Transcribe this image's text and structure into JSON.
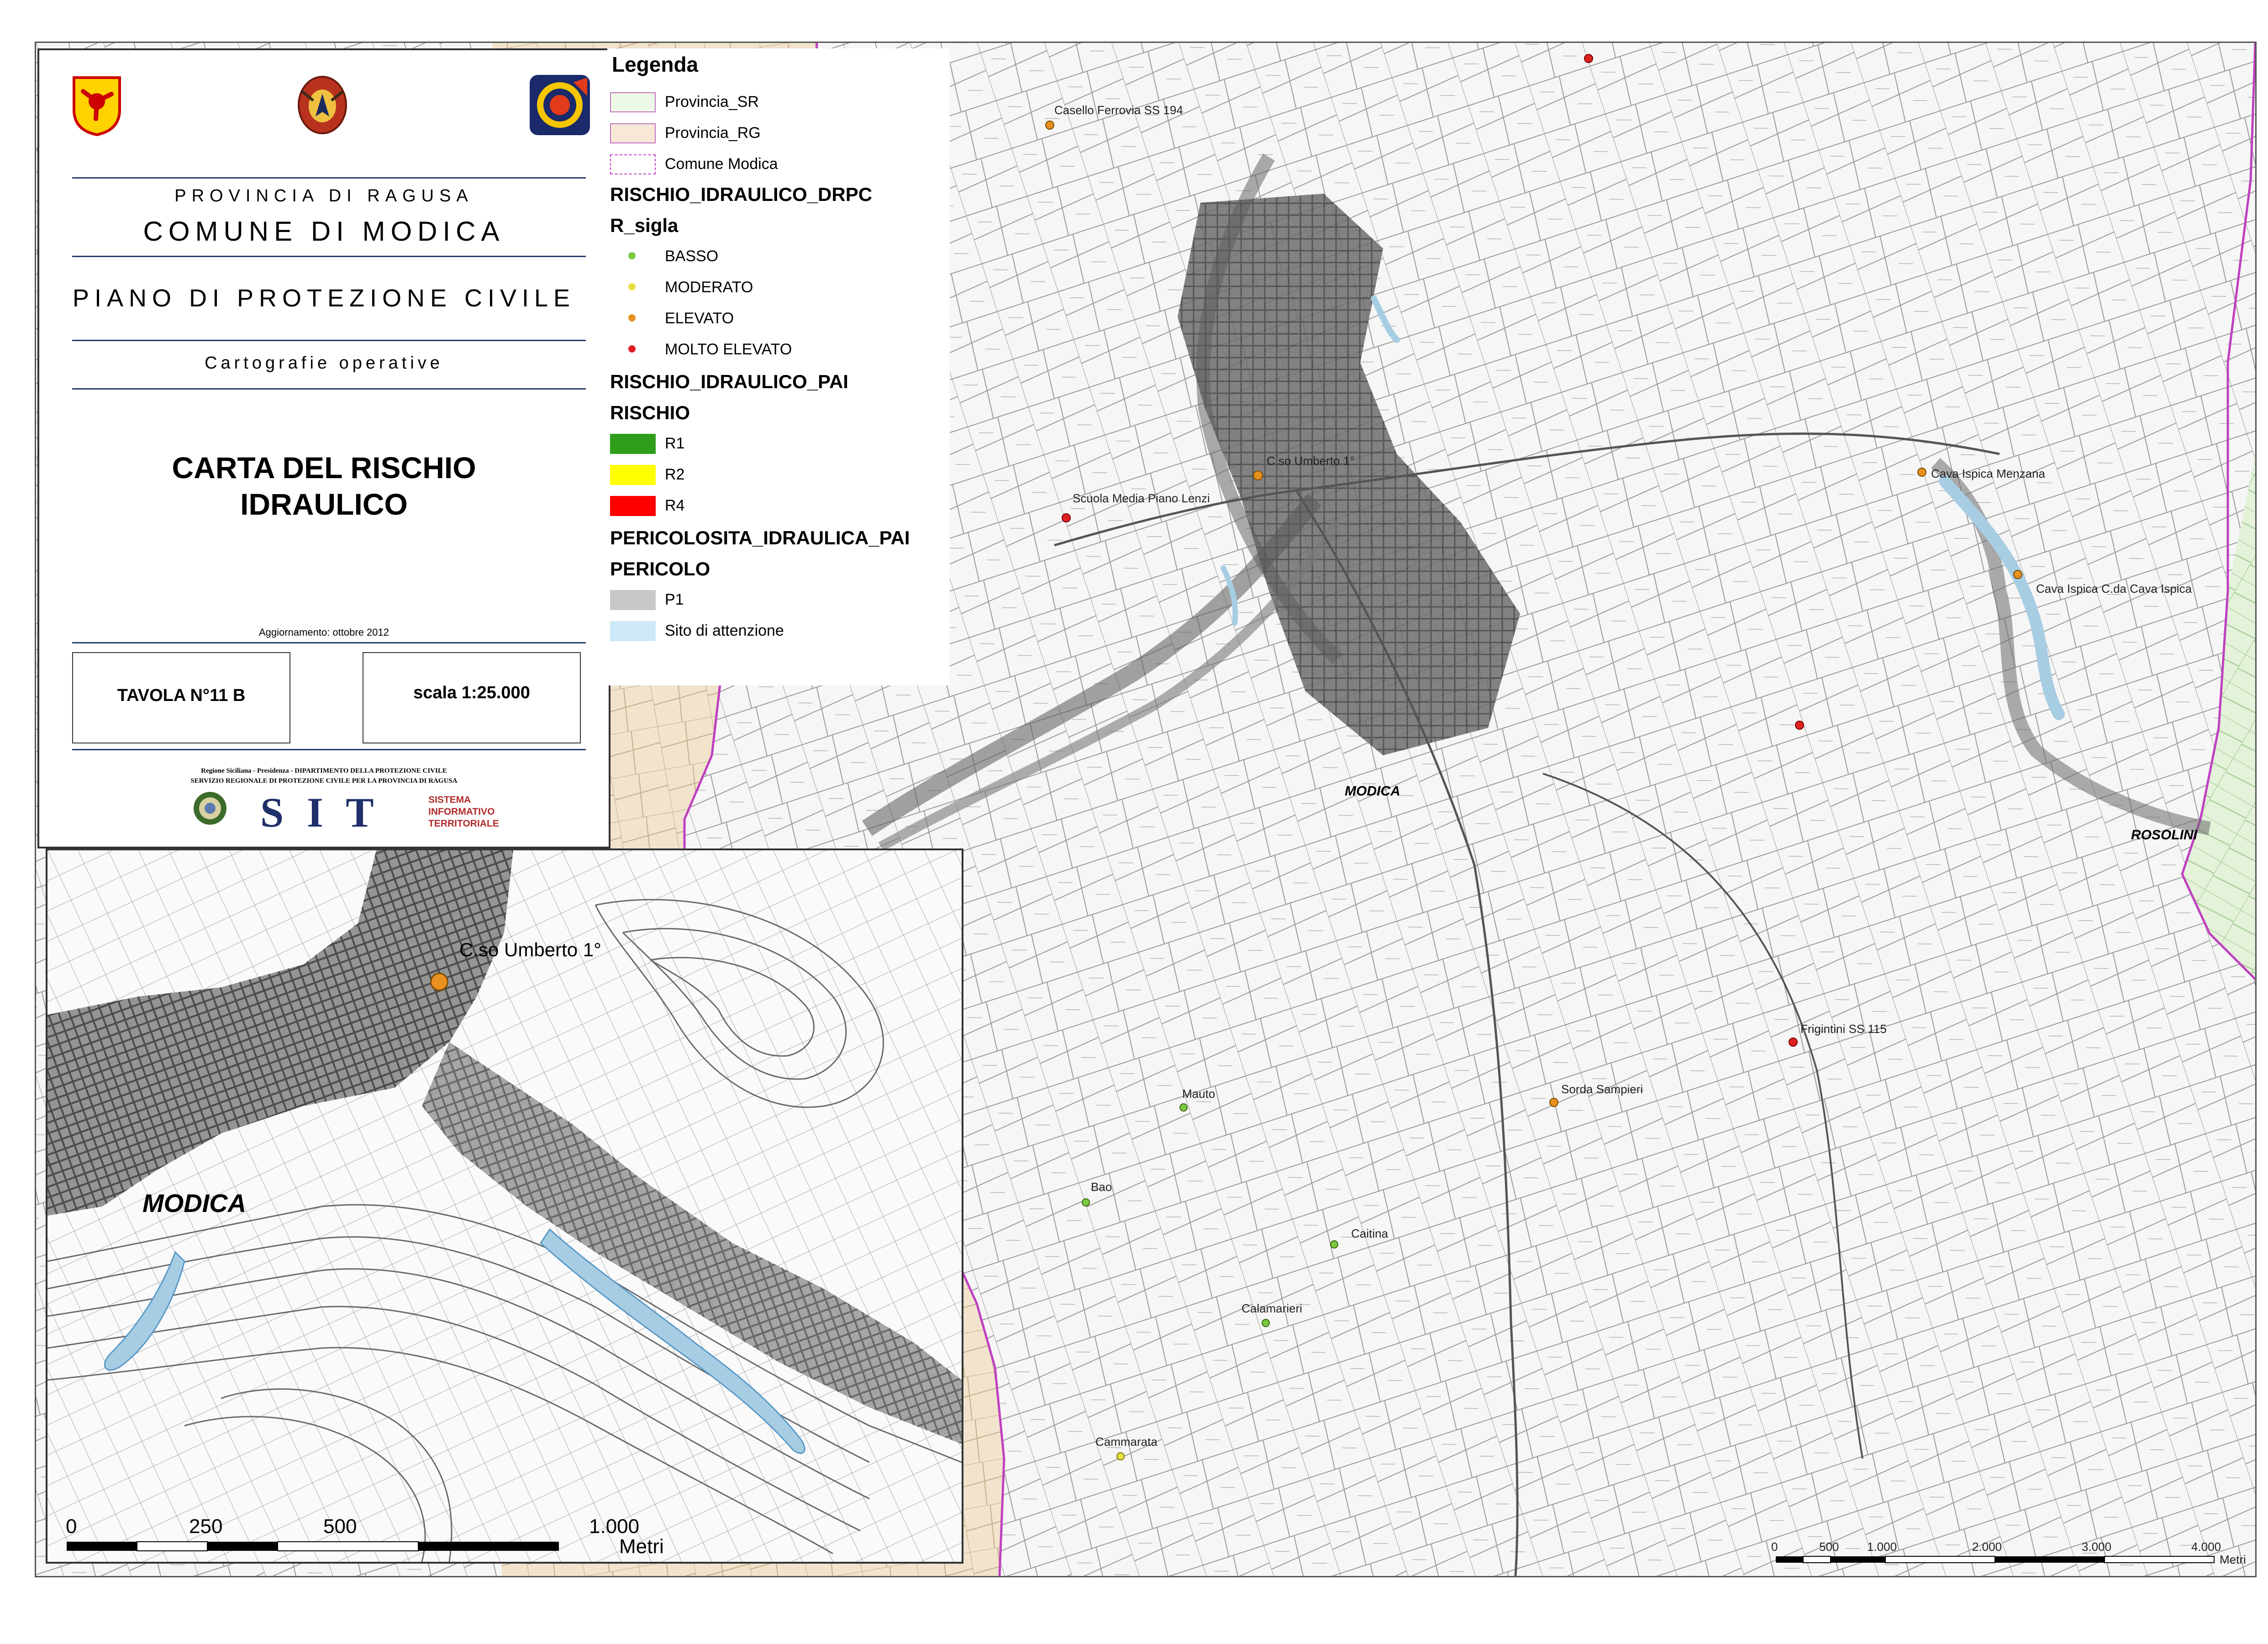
{
  "title_panel": {
    "province": "PROVINCIA DI RAGUSA",
    "comune": "COMUNE DI MODICA",
    "plan": "PIANO DI PROTEZIONE CIVILE",
    "subtitle": "Cartografie operative",
    "map_title_line1": "CARTA DEL RISCHIO",
    "map_title_line2": "IDRAULICO",
    "update": "Aggiornamento: ottobre 2012",
    "tavola": "TAVOLA N°11 B",
    "scala": "scala 1:25.000",
    "footer_line1": "Regione Siciliana - Presidenza - DIPARTIMENTO DELLA PROTEZIONE CIVILE",
    "footer_line2": "SERVIZIO REGIONALE DI PROTEZIONE CIVILE PER LA PROVINCIA DI RAGUSA",
    "sit": "S I T",
    "sit_caption": [
      "SISTEMA",
      "INFORMATIVO",
      "TERRITORIALE"
    ]
  },
  "legend": {
    "title": "Legenda",
    "boundaries": [
      {
        "label": "Provincia_SR",
        "fill": "#eef8e6",
        "stroke": "#c070c0"
      },
      {
        "label": "Provincia_RG",
        "fill": "#f8e8d8",
        "stroke": "#c070c0"
      },
      {
        "label": "Comune Modica",
        "fill": "#ffffff",
        "stroke": "#c040c0"
      }
    ],
    "drpc_title": "RISCHIO_IDRAULICO_DRPC",
    "drpc_field": "R_sigla",
    "drpc_items": [
      {
        "label": "BASSO",
        "color": "#7cc840"
      },
      {
        "label": "MODERATO",
        "color": "#e8e040"
      },
      {
        "label": "ELEVATO",
        "color": "#e89020"
      },
      {
        "label": "MOLTO ELEVATO",
        "color": "#e02020"
      }
    ],
    "pai_title": "RISCHIO_IDRAULICO_PAI",
    "pai_field": "RISCHIO",
    "pai_items": [
      {
        "label": "R1",
        "color": "#2e9e1a"
      },
      {
        "label": "R2",
        "color": "#ffff00"
      },
      {
        "label": "R4",
        "color": "#ff0000"
      }
    ],
    "per_title": "PERICOLOSITA_IDRAULICA_PAI",
    "per_field": "PERICOLO",
    "per_items": [
      {
        "label": "P1",
        "color": "#c8c8c8"
      },
      {
        "label": "Sito di attenzione",
        "color": "#cde8f6"
      }
    ]
  },
  "main_map": {
    "town_modica": "MODICA",
    "town_rosolini": "ROSOLINI",
    "points": [
      {
        "label": "Casello Ferrovia SS 194",
        "level": "ELEVATO"
      },
      {
        "label": "C.so Umberto 1°",
        "level": "ELEVATO"
      },
      {
        "label": "Cava Ispica Menzana",
        "level": "ELEVATO"
      },
      {
        "label": "Cava Ispica C.da Cava Ispica",
        "level": "ELEVATO"
      },
      {
        "label": "Scuola Media Piano Lenzi",
        "level": "MOLTO ELEVATO"
      },
      {
        "label": "Sorda Sampieri",
        "level": "ELEVATO"
      },
      {
        "label": "Frigintini SS 115",
        "level": "MOLTO ELEVATO"
      },
      {
        "label": "Mauto",
        "level": "BASSO"
      },
      {
        "label": "Bao",
        "level": "BASSO"
      },
      {
        "label": "Calamarieri",
        "level": "BASSO"
      },
      {
        "label": "Cammarata",
        "level": "MODERATO"
      },
      {
        "label": "Caitina",
        "level": "BASSO"
      }
    ],
    "scale_ticks": [
      "0",
      "500",
      "1.000",
      "2.000",
      "3.000",
      "4.000"
    ],
    "scale_unit": "Metri"
  },
  "inset": {
    "town": "MODICA",
    "point_label": "C.so Umberto 1°",
    "scale_ticks": [
      "0",
      "250",
      "500",
      "1.000"
    ],
    "scale_unit": "Metri"
  }
}
